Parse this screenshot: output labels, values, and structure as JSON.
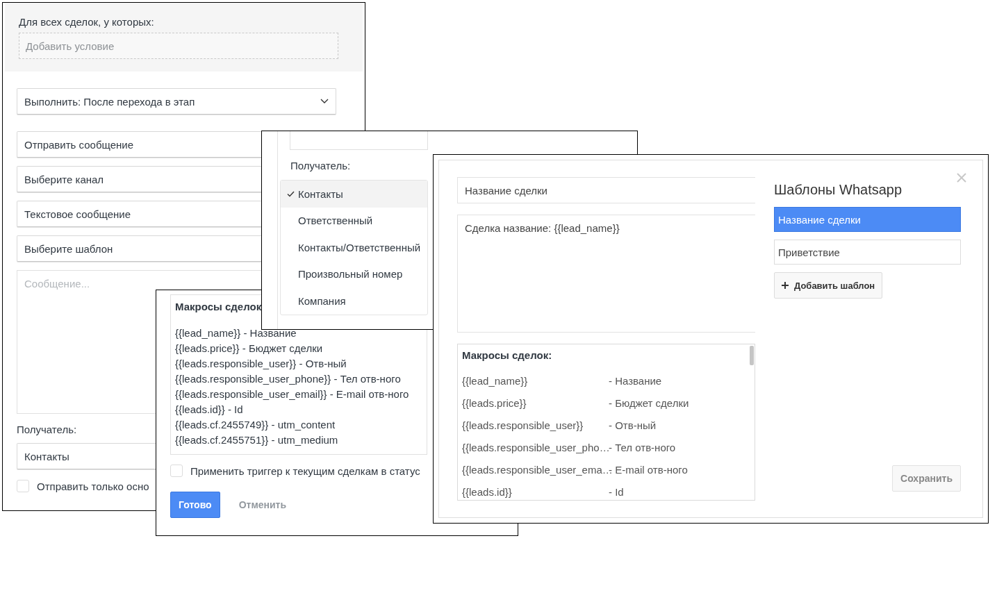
{
  "trigger_panel": {
    "condition_label": "Для всех сделок, у которых:",
    "add_condition": "Добавить условие",
    "execute_select": "Выполнить: После перехода в этап",
    "action_fields": [
      "Отправить сообщение",
      "Выберите канал",
      "Текстовое сообщение",
      "Выберите шаблон"
    ],
    "message": {
      "placeholder": "Сообщение..."
    },
    "recipient_label": "Получатель:",
    "recipient_select": "Контакты",
    "only_main_checkbox": {
      "label": "Отправить только осно",
      "checked": false
    }
  },
  "macros_dialog": {
    "title": "Макросы сделок",
    "macros": [
      "{{lead_name}} - Название",
      "{{leads.price}} - Бюджет сделки",
      "{{leads.responsible_user}} - Отв-ный",
      "{{leads.responsible_user_phone}} - Тел отв-ного",
      "{{leads.responsible_user_email}} - E-mail отв-ного",
      "{{leads.id}} - Id",
      "{{leads.cf.2455749}} - utm_content",
      "{{leads.cf.2455751}} - utm_medium"
    ],
    "apply_checkbox": {
      "label": "Применить триггер к текущим сделкам в статус",
      "checked": false
    },
    "buttons": [
      {
        "label": "Готово",
        "kind": "primary"
      },
      {
        "label": "Отменить",
        "kind": "link"
      }
    ]
  },
  "recipient_menu": {
    "label": "Получатель:",
    "options": [
      {
        "label": "Контакты",
        "selected": true
      },
      {
        "label": "Ответственный",
        "selected": false
      },
      {
        "label": "Контакты/Ответственный",
        "selected": false
      },
      {
        "label": "Произвольный номер",
        "selected": false
      },
      {
        "label": "Компания",
        "selected": false
      }
    ]
  },
  "template_editor": {
    "name_value": "Название сделки",
    "body_value": "Сделка название: {{lead_name}}",
    "macros_title": "Макросы сделок:",
    "macros": [
      {
        "code": "{{lead_name}}",
        "description": "- Название"
      },
      {
        "code": "{{leads.price}}",
        "description": "- Бюджет сделки"
      },
      {
        "code": "{{leads.responsible_user}}",
        "description": "- Отв-ный"
      },
      {
        "code": "{{leads.responsible_user_pho…",
        "description": "- Тел отв-ного"
      },
      {
        "code": "{{leads.responsible_user_ema…",
        "description": "- E-mail отв-ного"
      },
      {
        "code": "{{leads.id}}",
        "description": "- Id"
      }
    ],
    "title": "Шаблоны Whatsapp",
    "templates": [
      {
        "label": "Название сделки",
        "selected": true
      },
      {
        "label": "Приветствие",
        "selected": false
      }
    ],
    "add_button": "Добавить шаблон",
    "save_button": "Сохранить"
  }
}
